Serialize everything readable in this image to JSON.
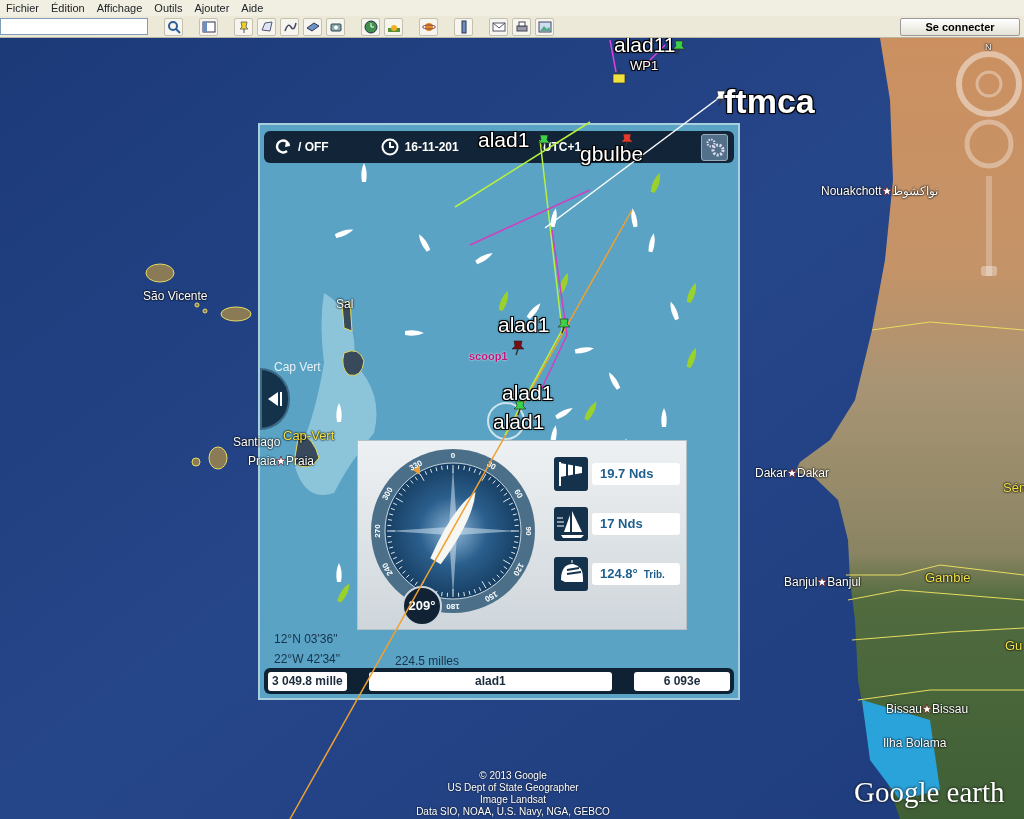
{
  "menu": [
    "Fichier",
    "Édition",
    "Affichage",
    "Outils",
    "Ajouter",
    "Aide"
  ],
  "toolbar": {
    "sign_in": "Se connecter"
  },
  "nav_north": "N",
  "places": [
    {
      "kind": "place",
      "text": "São Vicente"
    },
    {
      "kind": "place",
      "text": "Santiago"
    },
    {
      "kind": "country",
      "text": "Cap-Vert"
    },
    {
      "kind": "capital",
      "text": "Praia",
      "text_2": "Praia"
    },
    {
      "kind": "capital",
      "text": "Nouakchott",
      "text_2": "نواكشوط"
    },
    {
      "kind": "capital",
      "text": "Dakar",
      "text_2": "Dakar"
    },
    {
      "kind": "capital",
      "text": "Banjul",
      "text_2": "Banjul"
    },
    {
      "kind": "country",
      "text": "Gambie"
    },
    {
      "kind": "country",
      "text": "Sén"
    },
    {
      "kind": "country",
      "text": "Gu"
    },
    {
      "kind": "capital",
      "text": "Bissau",
      "text_2": "Bissau"
    },
    {
      "kind": "place",
      "text": "Ilha Bolama"
    }
  ],
  "attribution": [
    "© 2013 Google",
    "US Dept of State Geographer",
    "Image Landsat",
    "Data SIO, NOAA, U.S. Navy, NGA, GEBCO"
  ],
  "logo": "Google earth",
  "track_labels": [
    {
      "kind": "medium",
      "text": "alad11"
    },
    {
      "kind": "small",
      "text": "WP1"
    },
    {
      "kind": "large",
      "text": "ftmca"
    },
    {
      "kind": "medium",
      "text": "alad1"
    },
    {
      "kind": "medium",
      "text": "gbulbe"
    },
    {
      "kind": "medium",
      "text": "alad1"
    },
    {
      "kind": "note",
      "text": "scoop1"
    },
    {
      "kind": "medium",
      "text": "alad1"
    },
    {
      "kind": "medium",
      "text": "alad1"
    }
  ],
  "game_panel": {
    "sync": "/ OFF",
    "date": "16-11-201",
    "timezone": "UTC+1",
    "chart_places": [
      {
        "kind": "island",
        "text": "Sal"
      },
      {
        "kind": "sea",
        "text": "Cap Vert"
      }
    ],
    "compass": {
      "ticks": [
        "0",
        "30",
        "60",
        "90",
        "120",
        "150",
        "180",
        "240",
        "270",
        "300",
        "330"
      ],
      "heading": "209°"
    },
    "stats": [
      {
        "kind": "wind",
        "value": "19.7 Nds"
      },
      {
        "kind": "speed",
        "value": "17 Nds"
      },
      {
        "kind": "angle",
        "value": "124.8°",
        "suffix": "Trib."
      }
    ],
    "latitude": "12°N 03'36\"",
    "longitude": "22°W 42'34\"",
    "distance": "224.5 milles",
    "footer": {
      "remaining": "3 049.8 mille",
      "boat": "alad1",
      "rank": "6 093e"
    }
  }
}
